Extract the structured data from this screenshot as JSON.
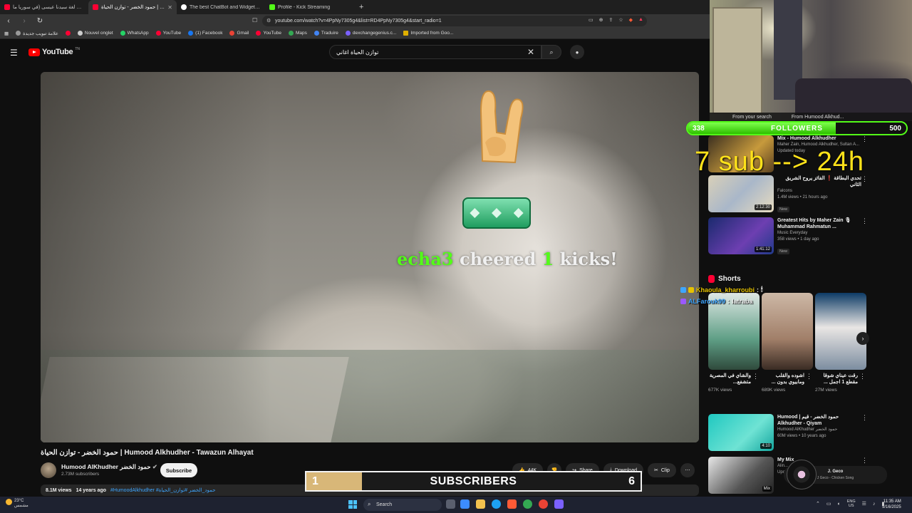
{
  "browser": {
    "tabs": [
      {
        "title": "يتحدثون لغة سيدنا عيسى (في سوريا ما",
        "active": false,
        "color": "#ff0033"
      },
      {
        "title": "حمود الخضر - توازن الحياة | Hu",
        "active": true,
        "color": "#ff0033"
      },
      {
        "title": "The best ChatBot and Widgets for Ki",
        "active": false,
        "color": "#ffffff"
      },
      {
        "title": "Profile - Kick Streaming",
        "active": false,
        "color": "#53fc18"
      }
    ],
    "new_tab": "+",
    "url": "youtube.com/watch?v=4PpNy7305g4&list=RD4PpNy7305g4&start_radio=1",
    "bookmarks": [
      {
        "label": "علامة تبويب جديدة",
        "color": "#999999"
      },
      {
        "label": "",
        "color": "#ff0033"
      },
      {
        "label": "Nouvel onglet",
        "color": "#cccccc"
      },
      {
        "label": "WhatsApp",
        "color": "#25d366"
      },
      {
        "label": "YouTube",
        "color": "#ff0033"
      },
      {
        "label": "(1) Facebook",
        "color": "#1877f2"
      },
      {
        "label": "Gmail",
        "color": "#ea4335"
      },
      {
        "label": "YouTube",
        "color": "#ff0033"
      },
      {
        "label": "Maps",
        "color": "#34a853"
      },
      {
        "label": "Traduire",
        "color": "#4285f4"
      },
      {
        "label": "dexchangegenius.c...",
        "color": "#7b61ff"
      },
      {
        "label": "Imported from Goo...",
        "color": "#e0b000"
      }
    ]
  },
  "youtube": {
    "logo_text": "YouTube",
    "logo_sup": "TN",
    "search_query": "توازن الحياة اغاني",
    "video": {
      "title": "حمود الخضر - توازن الحياة | Humood Alkhudher - Tawazun Alhayat",
      "channel": "Humood AlKhudher حمود الخضر",
      "subscribers": "2.73M subscribers",
      "subscribe_label": "Subscribe",
      "likes": "44K",
      "share_label": "Share",
      "download_label": "Download",
      "clip_label": "Clip",
      "views": "8.1M views",
      "age": "14 years ago",
      "tags": "#HumoodAlkhudher #حمود_الخضر #توازن_الحياة"
    },
    "sidebar": {
      "recommendations": [
        {
          "title": "Mix - Humood Alkhudher",
          "meta1": "Maher Zain, Humood Alkhudher, Sultan A...",
          "meta2": "Updated today",
          "badge": "",
          "duration": ""
        },
        {
          "title": "تحدي البطاقة ❗ الفائز يروح الشريق الثاني",
          "meta1": "Falcons",
          "meta2": "1.4M views • 21 hours ago",
          "badge": "New",
          "duration": "2:12:30"
        },
        {
          "title": "Greatest Hits by Maher Zain 🎙 Muhammad Rahmatun ...",
          "meta1": "Music Everyday",
          "meta2": "358 views • 1 day ago",
          "badge": "New",
          "duration": "1:41:12"
        }
      ],
      "shorts_heading": "Shorts",
      "shorts": [
        {
          "title": "والشاي في المصرية متشفع...",
          "views": "677K views"
        },
        {
          "title": "اشوده والقلب ومابيوي بدون ...",
          "views": "689K views"
        },
        {
          "title": "رقت عيناي شوقا مقطع 1 اجمل ...",
          "views": "27M views"
        }
      ],
      "more": [
        {
          "title": "Humood | حمود الخضر - قيم Alkhudher - Qiyam",
          "meta1": "Humood AlKhudher حمود الخضر",
          "meta2": "60M views • 10 years ago",
          "duration": "4:10"
        },
        {
          "title": "My Mix",
          "meta1": "Alin...",
          "meta2": "Upc...",
          "duration": "Mix"
        }
      ]
    }
  },
  "stream_overlay": {
    "alert_user": "echa3",
    "alert_mid": "cheered",
    "alert_amount": "1",
    "alert_unit": "kicks!",
    "followers": {
      "current": "338",
      "label": "FOLLOWERS",
      "goal": "500",
      "progress": 0.676
    },
    "sub_goal_text": "7 sub --> 24h",
    "chat": [
      {
        "user": "Khaoula_kharroubi",
        "msg": "🕯",
        "color": "#e6c200"
      },
      {
        "user": "ALFarouk99",
        "msg": "latraba",
        "color": "#3ea6ff"
      }
    ],
    "subscribers_bar": {
      "current": "1",
      "label": "SUBSCRIBERS",
      "goal": "6",
      "progress": 0.1667
    },
    "now_playing": {
      "artist": "J. Geco",
      "track": "J Geco - Chicken Song"
    },
    "webcam_overlay": [
      "From your search",
      "From Humood Alkhud..."
    ]
  },
  "taskbar": {
    "temp": "23°C",
    "weather": "مشمس",
    "search_label": "Search",
    "lang_top": "ENG",
    "lang_bottom": "US",
    "time": "11:35 AM",
    "date": "9/16/2025"
  }
}
